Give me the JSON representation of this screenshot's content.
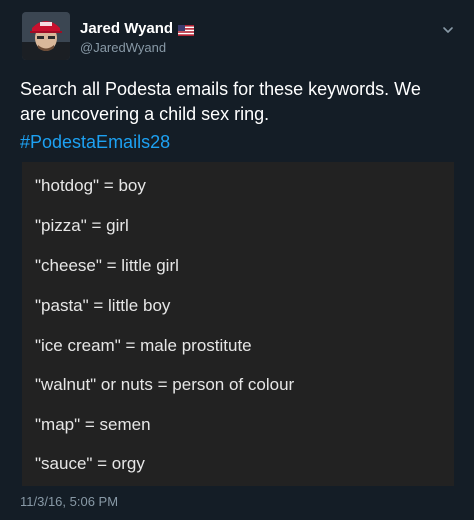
{
  "tweet": {
    "author_name": "Jared Wyand",
    "author_handle": "@JaredWyand",
    "flag_icon": "us-flag-icon",
    "text": "Search all Podesta emails for these keywords. We are uncovering a child sex ring.",
    "hashtag": "#PodestaEmails28",
    "timestamp": "11/3/16, 5:06 PM"
  },
  "keyword_list": [
    "\"hotdog\" = boy",
    "\"pizza\" = girl",
    "\"cheese\" = little girl",
    "\"pasta\" = little boy",
    "\"ice cream\" = male prostitute",
    "\"walnut\" or nuts = person of colour",
    "\"map\" = semen",
    "\"sauce\" = orgy"
  ],
  "colors": {
    "background": "#141d26",
    "card": "#222222",
    "link": "#1da1f2",
    "secondary_text": "#8899a6"
  }
}
